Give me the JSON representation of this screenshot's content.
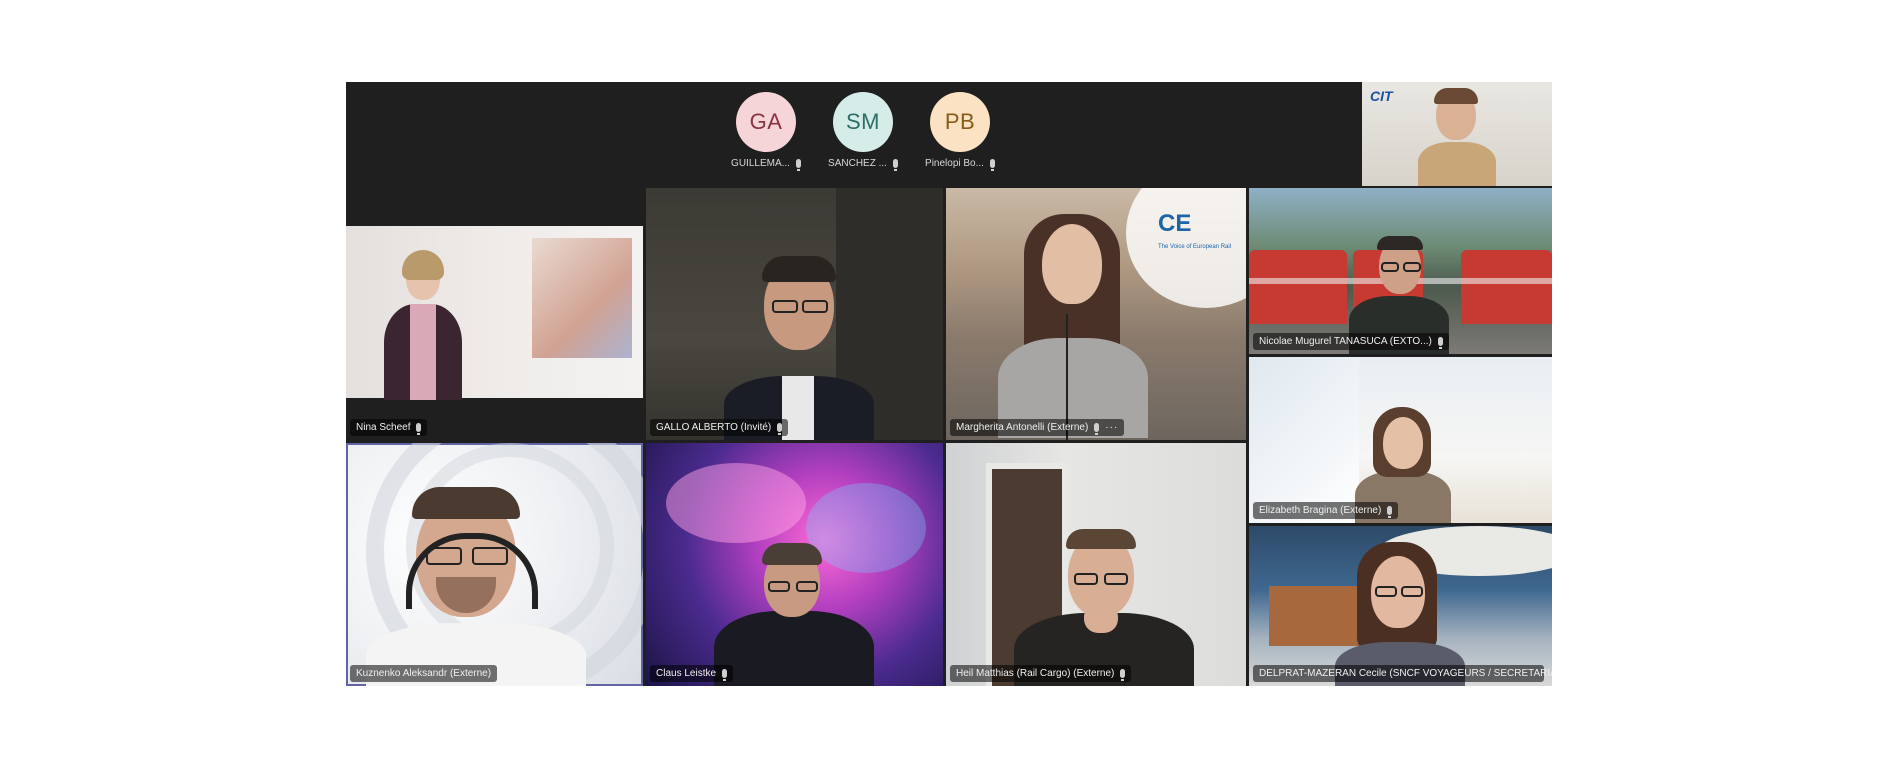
{
  "call": {
    "top_participants": [
      {
        "initials": "GA",
        "name": "GUILLEMA...",
        "bg": "#f6d5d8",
        "fg": "#8a3344"
      },
      {
        "initials": "SM",
        "name": "SANCHEZ ...",
        "bg": "#d5ece9",
        "fg": "#2e6e66"
      },
      {
        "initials": "PB",
        "name": "Pinelopi Bo...",
        "bg": "#fae2c3",
        "fg": "#8a5a1c"
      }
    ],
    "self_view": {
      "logo_text": "CIT"
    },
    "tiles": [
      {
        "label": "Nina Scheef",
        "muted": true
      },
      {
        "label": "GALLO ALBERTO (Invité)",
        "muted": true
      },
      {
        "label": "Margherita Antonelli (Externe)",
        "muted": true,
        "more": "···",
        "bg_logo": "CE",
        "bg_tagline": "The Voice of European Rail"
      },
      {
        "label": "Nicolae Mugurel TANASUCA (EXTO...)",
        "muted": true
      },
      {
        "label": "Elizabeth Bragina (Externe)",
        "muted": true
      },
      {
        "label": "Kuznenko Aleksandr (Externe)",
        "muted": false
      },
      {
        "label": "Claus Leistke",
        "muted": true
      },
      {
        "label": "Heil Matthias (Rail Cargo) (Externe)",
        "muted": true
      },
      {
        "label": "DELPRAT-MAZERAN Cecile (SNCF VOYAGEURS / SECRETARIAT ...",
        "muted": false
      }
    ]
  }
}
